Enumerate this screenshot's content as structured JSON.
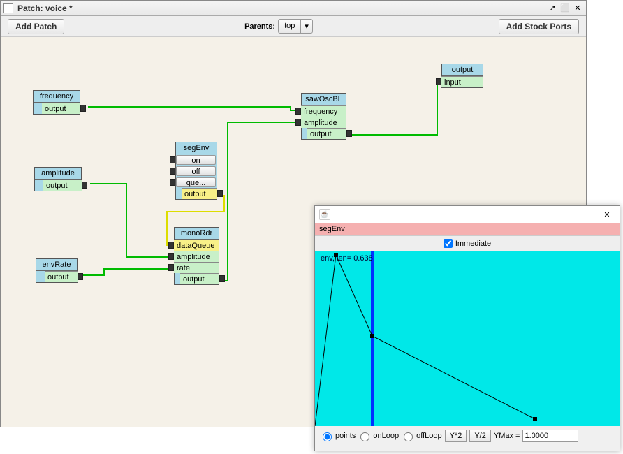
{
  "window": {
    "title": "Patch: voice *"
  },
  "toolbar": {
    "add_patch": "Add Patch",
    "parents_label": "Parents:",
    "parent_selected": "top",
    "add_stock_ports": "Add Stock Ports"
  },
  "nodes": {
    "frequency": {
      "title": "frequency",
      "output": "output"
    },
    "amplitude": {
      "title": "amplitude",
      "output": "output"
    },
    "envRate": {
      "title": "envRate",
      "output": "output"
    },
    "segEnv": {
      "title": "segEnv",
      "on": "on",
      "off": "off",
      "que": "que...",
      "output": "output"
    },
    "monoRdr": {
      "title": "monoRdr",
      "dataQueue": "dataQueue",
      "amplitude": "amplitude",
      "rate": "rate",
      "output": "output"
    },
    "sawOscBL": {
      "title": "sawOscBL",
      "frequency": "frequency",
      "amplitude": "amplitude",
      "output": "output"
    },
    "output_node": {
      "title": "output",
      "input": "input"
    }
  },
  "envEditor": {
    "header": "segEnv",
    "immediate_label": "Immediate",
    "canvas_label": "env, len=  0.638",
    "radio_points": "points",
    "radio_onLoop": "onLoop",
    "radio_offLoop": "offLoop",
    "btn_ymul2": "Y*2",
    "btn_ydiv2": "Y/2",
    "ymax_label": "YMax =",
    "ymax_value": "1.0000"
  }
}
